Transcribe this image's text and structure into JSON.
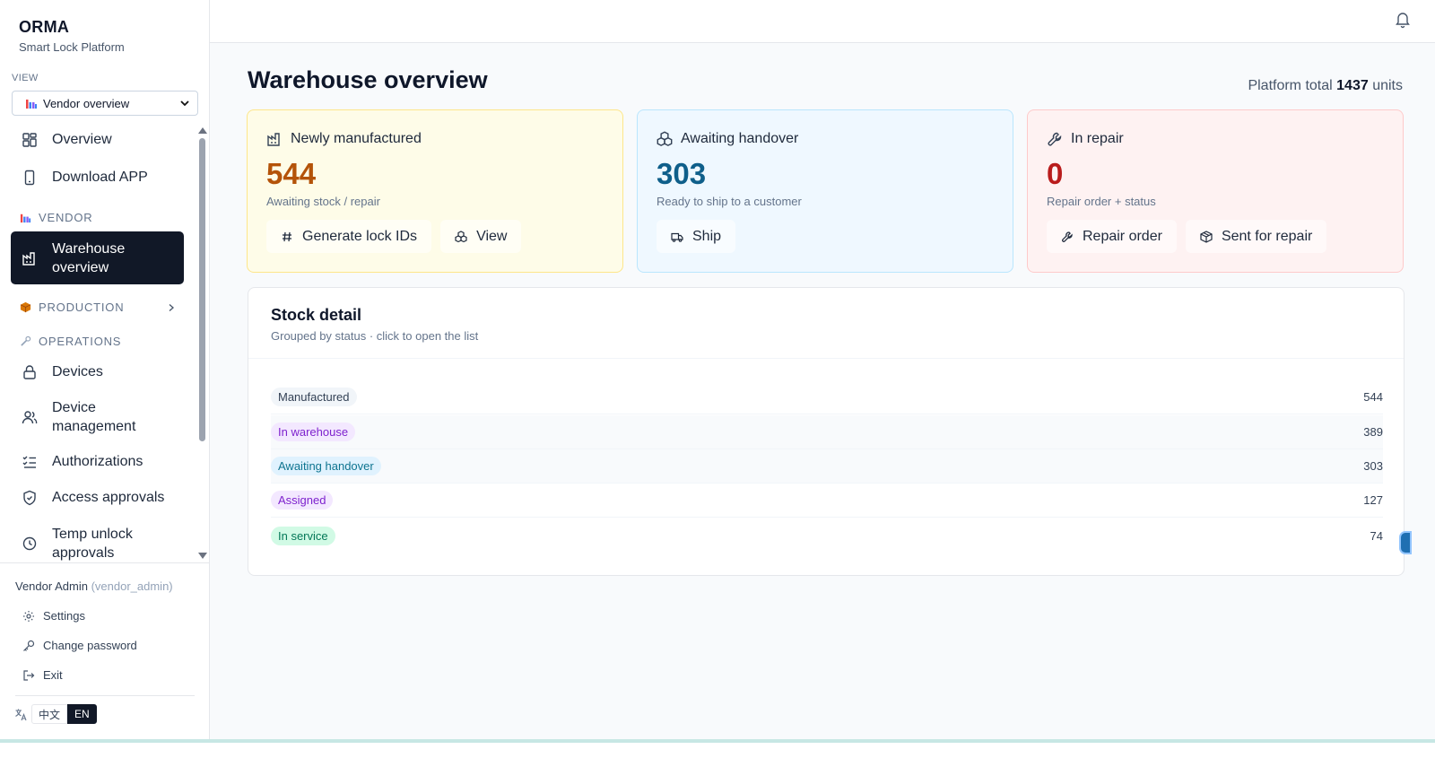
{
  "brand": {
    "name": "ORMA",
    "subtitle": "Smart Lock Platform"
  },
  "view": {
    "label": "VIEW",
    "selected": "Vendor overview"
  },
  "nav": {
    "overview": "Overview",
    "download_app": "Download APP",
    "section_vendor": "VENDOR",
    "warehouse_overview_1": "Warehouse",
    "warehouse_overview_2": "overview",
    "section_production": "PRODUCTION",
    "section_operations": "OPERATIONS",
    "devices": "Devices",
    "device_management_1": "Device",
    "device_management_2": "management",
    "authorizations": "Authorizations",
    "access_approvals": "Access approvals",
    "temp_unlock_1": "Temp unlock",
    "temp_unlock_2": "approvals"
  },
  "footer": {
    "user_name": "Vendor Admin",
    "user_role": "(vendor_admin)",
    "settings": "Settings",
    "change_password": "Change password",
    "exit": "Exit",
    "lang_zh": "中文",
    "lang_en": "EN"
  },
  "main": {
    "title": "Warehouse overview",
    "platform_total_prefix": "Platform total",
    "platform_total_value": "1437",
    "platform_total_suffix": "units"
  },
  "cards": [
    {
      "title": "Newly manufactured",
      "value": "544",
      "subtitle": "Awaiting stock / repair",
      "buttons": [
        "Generate lock IDs",
        "View"
      ],
      "accent": "#b45309",
      "bg": "#fefce8",
      "border": "#fde68a"
    },
    {
      "title": "Awaiting handover",
      "value": "303",
      "subtitle": "Ready to ship to a customer",
      "buttons": [
        "Ship"
      ],
      "accent": "#0f5f8a",
      "bg": "#eff8ff",
      "border": "#bae6fd"
    },
    {
      "title": "In repair",
      "value": "0",
      "subtitle": "Repair order + status",
      "buttons": [
        "Repair order",
        "Sent for repair"
      ],
      "accent": "#b91c1c",
      "bg": "#fef2f2",
      "border": "#fecaca"
    }
  ],
  "stock": {
    "title": "Stock detail",
    "subtitle": "Grouped by status · click to open the list",
    "rows": [
      {
        "status": "Manufactured",
        "count": "544",
        "color": "#334155",
        "bg": "#f1f5f9"
      },
      {
        "status": "In warehouse",
        "count": "389",
        "color": "#7e22ce",
        "bg": "#f3e8ff"
      },
      {
        "status": "Awaiting handover",
        "count": "303",
        "color": "#0e7490",
        "bg": "#e0f2fe"
      },
      {
        "status": "Assigned",
        "count": "127",
        "color": "#7e22ce",
        "bg": "#f3e8ff"
      },
      {
        "status": "In service",
        "count": "74",
        "color": "#047857",
        "bg": "#d1fae5"
      }
    ]
  }
}
